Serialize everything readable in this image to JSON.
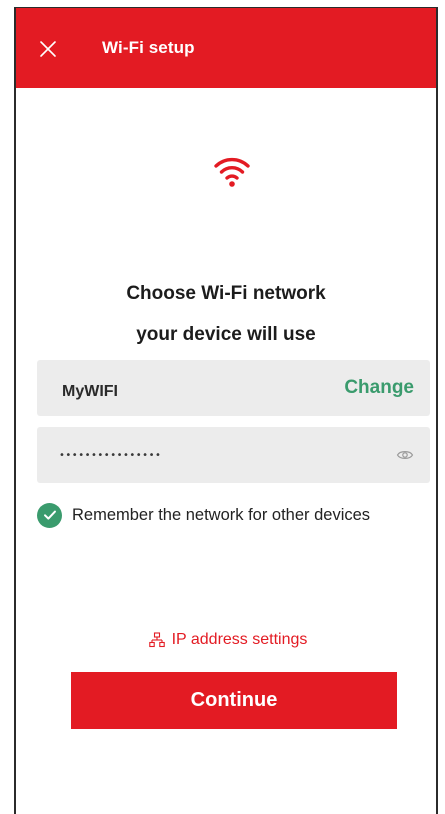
{
  "header": {
    "title": "Wi-Fi setup",
    "close_icon": "close-icon",
    "background_color": "#e31b23"
  },
  "hero": {
    "icon": "wifi-icon",
    "heading_line1": "Choose Wi-Fi network",
    "heading_line2": "your device will use"
  },
  "network": {
    "ssid": "MyWIFI",
    "change_label": "Change"
  },
  "password": {
    "value": "••••••••••••••••",
    "visibility_icon": "eye-icon"
  },
  "remember": {
    "checked": true,
    "label": "Remember the network for other devices"
  },
  "ip_settings": {
    "icon": "network-icon",
    "label": "IP address settings"
  },
  "continue": {
    "label": "Continue"
  },
  "colors": {
    "accent": "#e31b23",
    "success": "#3a9b6d",
    "field_bg": "#ececec"
  }
}
